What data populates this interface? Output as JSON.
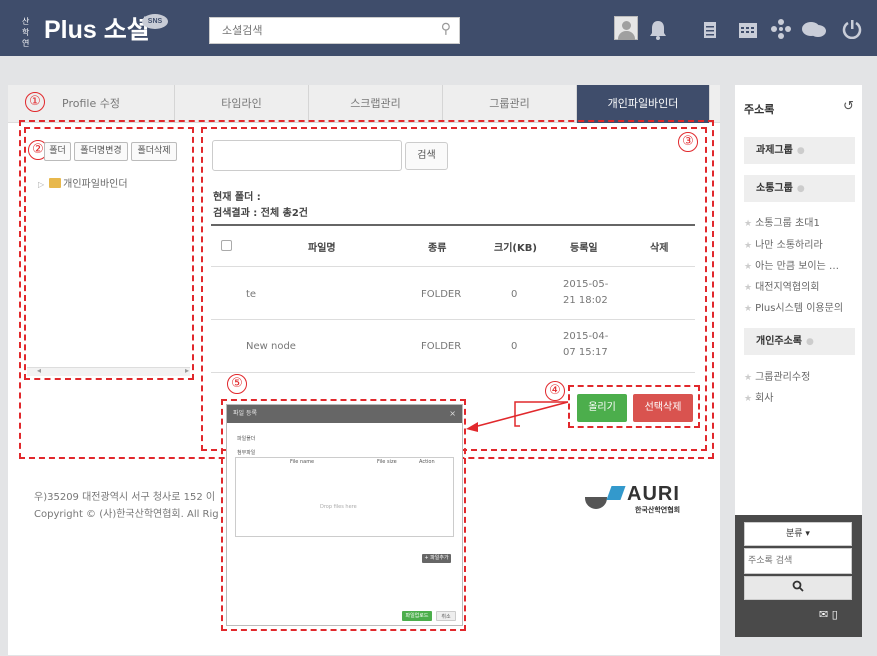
{
  "header": {
    "logo_small": "산학연",
    "logo_main": "Plus 소셜",
    "logo_bubble": "SNS",
    "search_placeholder": "소셜검색"
  },
  "header_icons": [
    "avatar-icon",
    "bell-icon",
    "document-icon",
    "calendar-icon",
    "people-icon",
    "chat-icon",
    "power-icon"
  ],
  "tabs": [
    {
      "label": "Profile 수정",
      "active": false
    },
    {
      "label": "타임라인",
      "active": false
    },
    {
      "label": "스크랩관리",
      "active": false
    },
    {
      "label": "그룹관리",
      "active": false
    },
    {
      "label": "개인파일바인더",
      "active": true
    }
  ],
  "annotations": {
    "n1": "①",
    "n2": "②",
    "n3": "③",
    "n4": "④",
    "n5": "⑤"
  },
  "folder_buttons": {
    "add": "폴더",
    "rename": "폴더명변경",
    "delete": "폴더삭제"
  },
  "tree": {
    "root": "개인파일바인더"
  },
  "file_search": {
    "value": "",
    "button": "검색"
  },
  "info": {
    "current_folder": "현재 폴더 :",
    "result": "검색결과 : 전체 총2건"
  },
  "table": {
    "headers": {
      "name": "파일명",
      "type": "종류",
      "size": "크기(KB)",
      "date": "등록일",
      "delete": "삭제"
    },
    "rows": [
      {
        "name": "te",
        "type": "FOLDER",
        "size": "0",
        "date1": "2015-05-",
        "date2": "21 18:02"
      },
      {
        "name": "New node",
        "type": "FOLDER",
        "size": "0",
        "date1": "2015-04-",
        "date2": "07 15:17"
      }
    ]
  },
  "actions": {
    "upload": "올리기",
    "delete_selected": "선택삭제"
  },
  "footer": {
    "address": "우)35209 대전광역시 서구 청사로 152 이",
    "copyright": "Copyright © (사)한국산학연협회. All Rig"
  },
  "brand": {
    "name": "AURI",
    "sub": "한국산학연협회"
  },
  "modal": {
    "title": "파일 등록",
    "close": "×",
    "label1": "파일폴더",
    "label2": "첨부파일",
    "col_name": "File name",
    "col_size": "File size",
    "col_action": "Action",
    "drop": "Drop files here",
    "add_btn": "+ 파일추가",
    "save_btn": "파일업로드",
    "cancel_btn": "취소"
  },
  "sidebar": {
    "title": "주소록",
    "groups": {
      "task": "과제그룹",
      "comm": "소통그룹",
      "personal": "개인주소록"
    },
    "comm_items": [
      "소통그룹 초대1",
      "나만 소통하리라",
      "아는 만큼 보이는 …",
      "대전지역협의회",
      "Plus시스템 이용문의"
    ],
    "personal_items": [
      "그룹관리수정",
      "회사"
    ],
    "sort_label": "분류 ▾",
    "search_placeholder": "주소록 검색",
    "search_icon": "🔍"
  },
  "colors": {
    "header": "#3f4d6b",
    "accent_red": "#e1282c",
    "green": "#4cae4c",
    "red": "#d9534f"
  }
}
